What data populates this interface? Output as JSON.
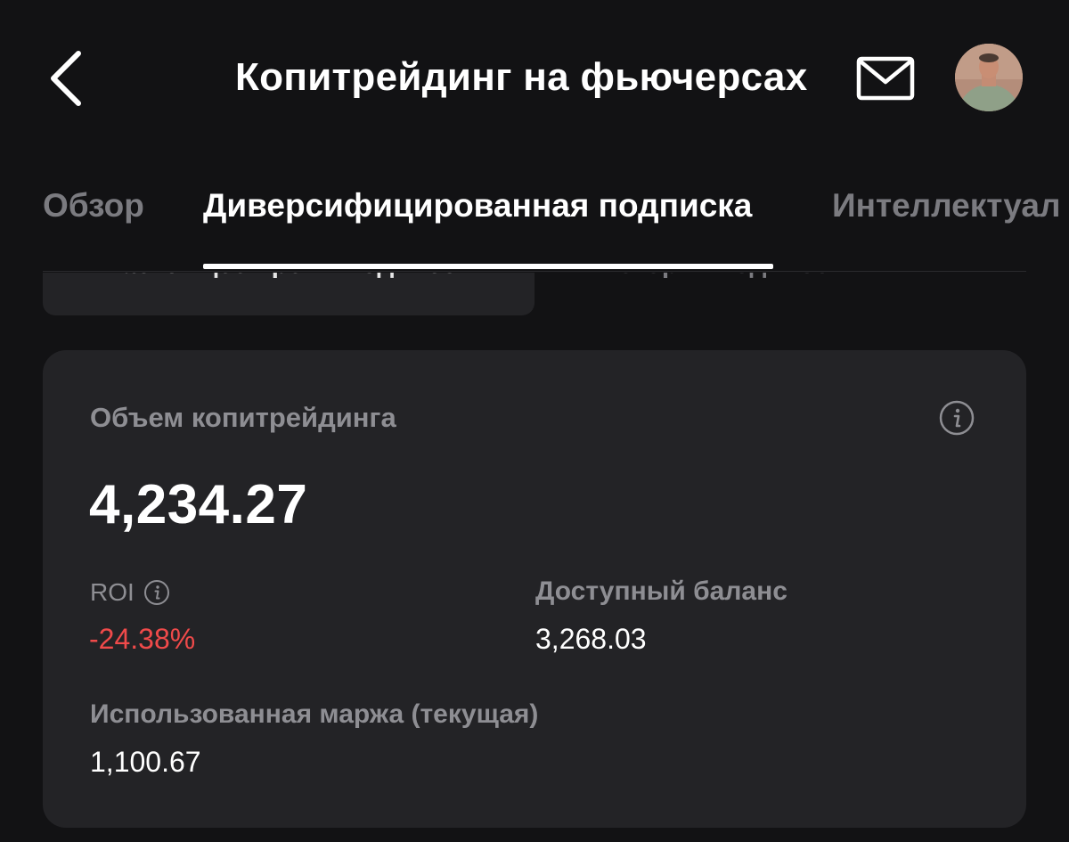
{
  "header": {
    "title": "Копитрейдинг на фьючерсах",
    "back_icon": "chevron-left-icon",
    "mail_icon": "mail-icon"
  },
  "tabs": [
    {
      "label": "Обзор",
      "active": false
    },
    {
      "label": "Диверсифицированная подписка",
      "active": true
    },
    {
      "label": "Интеллектуал",
      "active": false
    }
  ],
  "subtabs": [
    {
      "label": "В настоящее время подписок",
      "active": true
    },
    {
      "label": "История подписок",
      "active": false
    }
  ],
  "card": {
    "title": "Объем копитрейдинга",
    "volume": "4,234.27",
    "roi_label": "ROI",
    "roi_value": "-24.38%",
    "balance_label": "Доступный баланс",
    "balance_value": "3,268.03",
    "margin_label": "Использованная маржа (текущая)",
    "margin_value": "1,100.67"
  },
  "colors": {
    "background": "#121214",
    "card": "#232326",
    "muted_text": "#8e8e93",
    "negative": "#ef4a4a",
    "active_tab": "#ffffff"
  }
}
